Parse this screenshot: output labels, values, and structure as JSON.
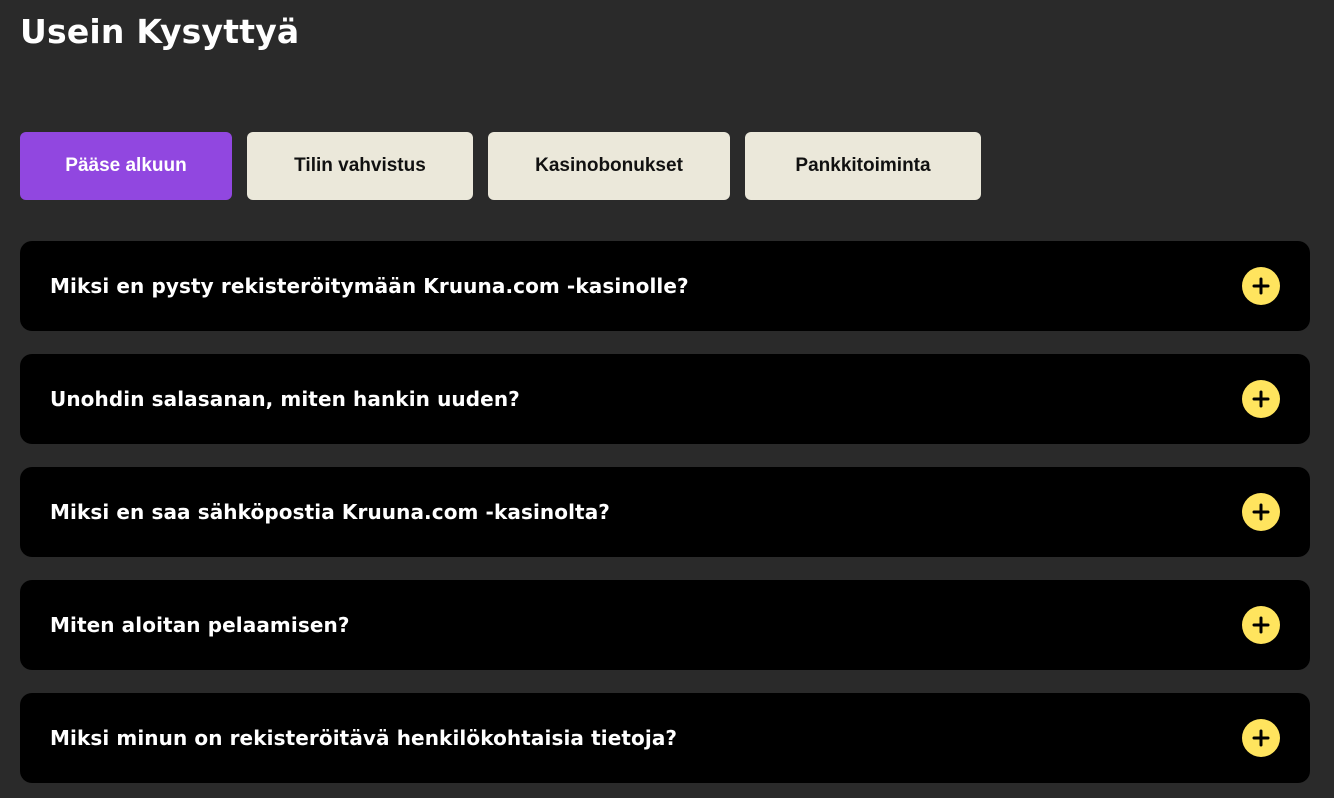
{
  "page": {
    "title": "Usein Kysyttyä"
  },
  "tabs": [
    {
      "label": "Pääse alkuun",
      "active": true
    },
    {
      "label": "Tilin vahvistus",
      "active": false
    },
    {
      "label": "Kasinobonukset",
      "active": false
    },
    {
      "label": "Pankkitoiminta",
      "active": false
    }
  ],
  "faq": [
    {
      "question": "Miksi en pysty rekisteröitymään Kruuna.com -kasinolle?",
      "icon": "plus-icon"
    },
    {
      "question": "Unohdin salasanan, miten hankin uuden?",
      "icon": "plus-icon"
    },
    {
      "question": "Miksi en saa sähköpostia Kruuna.com -kasinolta?",
      "icon": "plus-icon"
    },
    {
      "question": "Miten aloitan pelaamisen?",
      "icon": "plus-icon"
    },
    {
      "question": "Miksi minun on rekisteröitävä henkilökohtaisia tietoja?",
      "icon": "plus-icon"
    }
  ],
  "colors": {
    "background": "#2a2a2a",
    "active_tab": "#9147e0",
    "inactive_tab": "#ebe8da",
    "card": "#000000",
    "accent_yellow": "#ffe45e"
  }
}
